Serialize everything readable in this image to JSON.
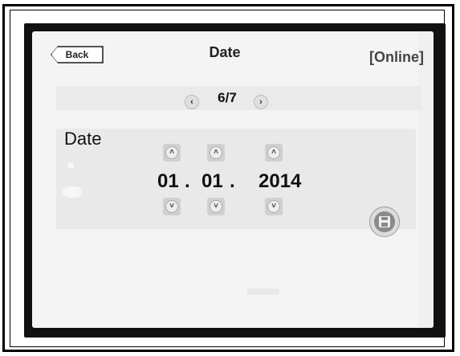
{
  "header": {
    "back_label": "Back",
    "title": "Date",
    "status": "[Online]"
  },
  "pager": {
    "text": "6/7",
    "prev_icon": "chevron-left-icon",
    "next_icon": "chevron-right-icon"
  },
  "date_panel": {
    "label": "Date",
    "day": "01",
    "month": "01",
    "year": "2014",
    "separator": ".",
    "up_icon": "chevron-up-icon",
    "down_icon": "chevron-down-icon",
    "save_icon": "save-icon"
  }
}
